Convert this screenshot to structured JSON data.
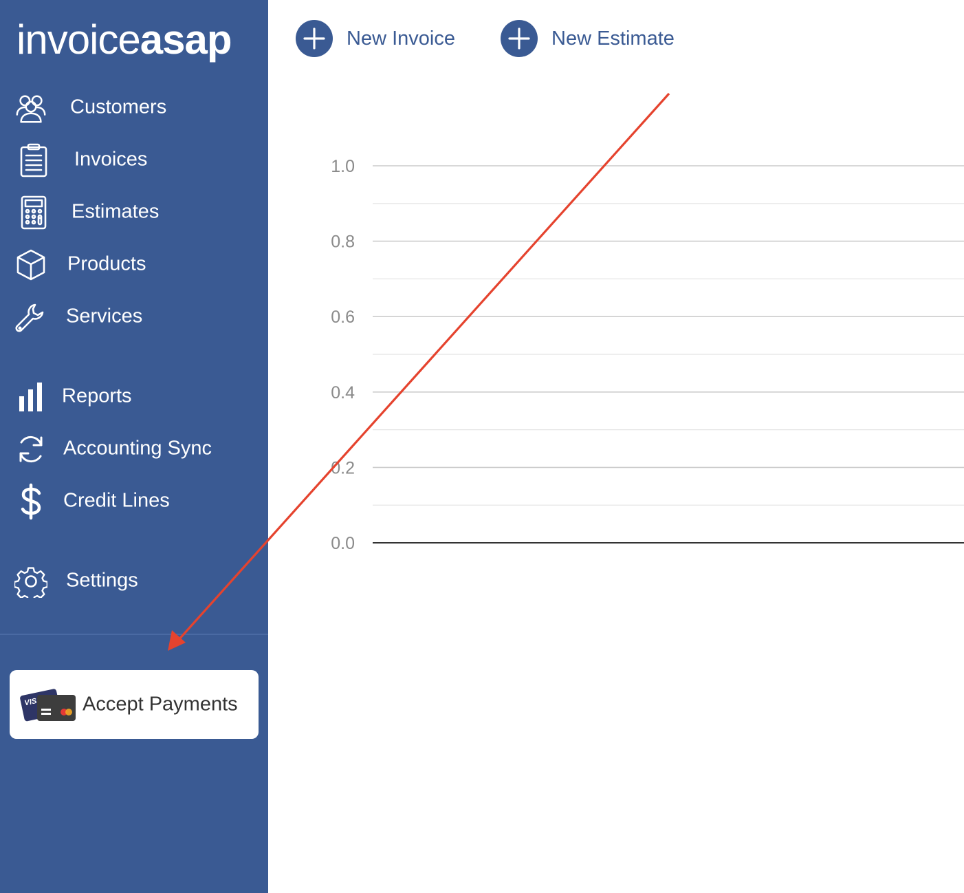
{
  "app": {
    "logo_light": "invoice",
    "logo_bold": "asap"
  },
  "sidebar": {
    "items": [
      {
        "label": "Customers",
        "icon": "users-icon"
      },
      {
        "label": "Invoices",
        "icon": "clipboard-icon"
      },
      {
        "label": "Estimates",
        "icon": "calculator-icon"
      },
      {
        "label": "Products",
        "icon": "box-icon"
      },
      {
        "label": "Services",
        "icon": "wrench-icon"
      },
      {
        "label": "Reports",
        "icon": "bar-chart-icon"
      },
      {
        "label": "Accounting Sync",
        "icon": "sync-icon"
      },
      {
        "label": "Credit Lines",
        "icon": "dollar-icon"
      },
      {
        "label": "Settings",
        "icon": "gear-icon"
      }
    ],
    "payments": {
      "label": "Accept Payments",
      "icon": "credit-cards-icon",
      "card_brand": "VISA"
    }
  },
  "toolbar": {
    "new_invoice": "New Invoice",
    "new_estimate": "New Estimate"
  },
  "colors": {
    "sidebar": "#3a5a93",
    "accent": "#3a5a93",
    "annotation_arrow": "#e5432e"
  },
  "chart_data": {
    "type": "line",
    "series": [],
    "y_ticks": [
      "1.0",
      "0.8",
      "0.6",
      "0.4",
      "0.2",
      "0.0"
    ],
    "ylim": [
      0,
      1
    ],
    "grid": true
  }
}
